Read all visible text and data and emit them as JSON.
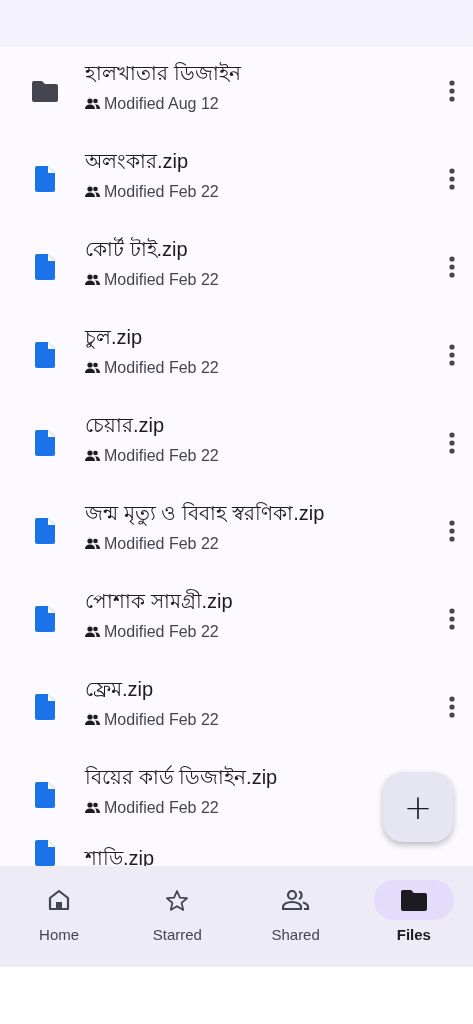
{
  "files": [
    {
      "kind": "folder",
      "name": "হালখাতার ডিজাইন",
      "modified": "Modified Aug 12",
      "menu": true
    },
    {
      "kind": "file",
      "name": "অলংকার.zip",
      "modified": "Modified Feb 22",
      "menu": true
    },
    {
      "kind": "file",
      "name": "কোর্ট টাই.zip",
      "modified": "Modified Feb 22",
      "menu": true
    },
    {
      "kind": "file",
      "name": "চুল.zip",
      "modified": "Modified Feb 22",
      "menu": true
    },
    {
      "kind": "file",
      "name": "চেয়ার.zip",
      "modified": "Modified Feb 22",
      "menu": true
    },
    {
      "kind": "file",
      "name": "জন্ম মৃত্যু ও বিবাহ স্বরণিকা.zip",
      "modified": "Modified Feb 22",
      "menu": true
    },
    {
      "kind": "file",
      "name": "পোশাক সামগ্রী.zip",
      "modified": "Modified Feb 22",
      "menu": true
    },
    {
      "kind": "file",
      "name": "ফ্রেম.zip",
      "modified": "Modified Feb 22",
      "menu": true
    },
    {
      "kind": "file",
      "name": "বিয়ের কার্ড ডিজাইন.zip",
      "modified": "Modified Feb 22",
      "menu": false
    },
    {
      "kind": "file",
      "name": "শাড়ি.zip"
    }
  ],
  "fab": {
    "label": "+"
  },
  "nav": [
    {
      "kind": "home",
      "label": "Home",
      "selected": false
    },
    {
      "kind": "starred",
      "label": "Starred",
      "selected": false
    },
    {
      "kind": "shared",
      "label": "Shared",
      "selected": false
    },
    {
      "kind": "files",
      "label": "Files",
      "selected": true
    }
  ]
}
